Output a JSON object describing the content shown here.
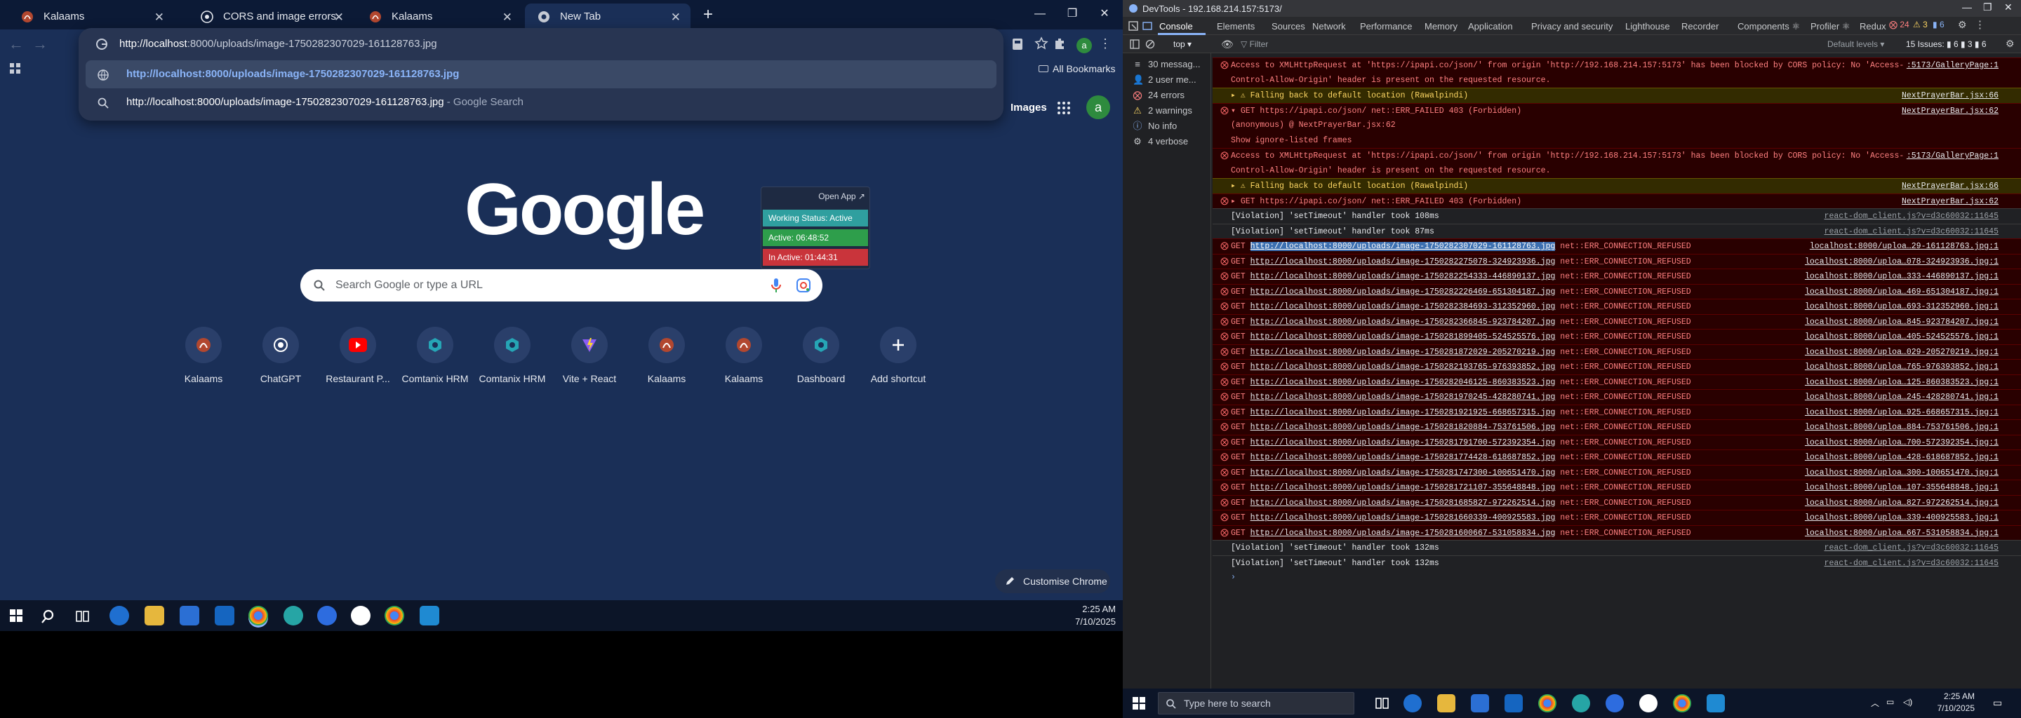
{
  "browser": {
    "tabs": [
      {
        "label": "Kalaams"
      },
      {
        "label": "CORS and image errors"
      },
      {
        "label": "Kalaams"
      },
      {
        "label": "New Tab"
      }
    ],
    "window_controls": {
      "minimize": "—",
      "maximize": "❐",
      "close": "✕"
    },
    "omnibox": {
      "value_host": "http://localhost",
      "value_path": ":8000/uploads/image-1750282307029-161128763.jpg",
      "suggestions": [
        {
          "text": "http://localhost:8000/uploads/image-1750282307029-161128763.jpg",
          "suffix": ""
        },
        {
          "text": "http://localhost:8000/uploads/image-1750282307029-161128763.jpg",
          "suffix": " - Google Search"
        }
      ]
    },
    "profile_initial": "a",
    "all_bookmarks": "All Bookmarks"
  },
  "newtab": {
    "images_link": "Images",
    "avatar_initial": "a",
    "logo": "Google",
    "search_placeholder": "Search Google or type a URL",
    "shortcuts": [
      {
        "label": "Kalaams",
        "icon": "kalaams-icon"
      },
      {
        "label": "ChatGPT",
        "icon": "chatgpt-icon"
      },
      {
        "label": "Restaurant P...",
        "icon": "youtube-icon"
      },
      {
        "label": "Comtanix HRM",
        "icon": "comtanix-icon"
      },
      {
        "label": "Comtanix HRM",
        "icon": "comtanix-icon"
      },
      {
        "label": "Vite + React",
        "icon": "vite-icon"
      },
      {
        "label": "Kalaams",
        "icon": "kalaams-icon"
      },
      {
        "label": "Kalaams",
        "icon": "kalaams-icon"
      },
      {
        "label": "Dashboard",
        "icon": "dashboard-icon"
      },
      {
        "label": "Add shortcut",
        "icon": "plus-icon"
      }
    ],
    "customise": "Customise Chrome"
  },
  "extension_popup": {
    "open_app": "Open App ↗",
    "working_status": "Working Status: Active",
    "active": "Active: 06:48:52",
    "inactive": "In Active: 01:44:31"
  },
  "taskbar_left": {
    "time": "2:25 AM",
    "date": "7/10/2025"
  },
  "devtools": {
    "title": "DevTools - 192.168.214.157:5173/",
    "tabs": [
      "Console",
      "Elements",
      "Sources",
      "Network",
      "Performance",
      "Memory",
      "Application",
      "Privacy and security",
      "Lighthouse",
      "Recorder",
      "Components ⚛",
      "Profiler ⚛",
      "Redux"
    ],
    "issue_counts": {
      "errors": "24",
      "warnings": "3",
      "info": "6"
    },
    "filter": {
      "context": "top ▾",
      "placeholder": "Filter",
      "levels": "Default levels ▾",
      "issues": "15 Issues: ▮ 6 ▮ 3 ▮ 6"
    },
    "sidebar": [
      {
        "label": "30 messag...",
        "icon": "list-icon"
      },
      {
        "label": "2 user me...",
        "icon": "user-icon"
      },
      {
        "label": "24 errors",
        "icon": "error-icon"
      },
      {
        "label": "2 warnings",
        "icon": "warning-icon"
      },
      {
        "label": "No info",
        "icon": "info-icon"
      },
      {
        "label": "4 verbose",
        "icon": "verbose-icon"
      }
    ],
    "log": [
      {
        "level": "err",
        "msg": "Access to XMLHttpRequest at 'https://ipapi.co/json/' from origin 'http://192.168.214.157:5173' has been blocked by CORS policy: No 'Access-",
        "src": ":5173/GalleryPage:1"
      },
      {
        "level": "err",
        "msg": "Control-Allow-Origin' header is present on the requested resource.",
        "src": "",
        "cont": true
      },
      {
        "level": "warn",
        "msg": "▸ ⚠ Falling back to default location (Rawalpindi)",
        "src": "NextPrayerBar.jsx:66"
      },
      {
        "level": "err",
        "msg": "▾ GET https://ipapi.co/json/ net::ERR_FAILED 403 (Forbidden)",
        "src": "NextPrayerBar.jsx:62"
      },
      {
        "level": "err",
        "msg": "    (anonymous) @ NextPrayerBar.jsx:62",
        "src": "",
        "cont": true
      },
      {
        "level": "err",
        "msg": "    Show ignore-listed frames",
        "src": "",
        "cont": true
      },
      {
        "level": "err",
        "msg": "Access to XMLHttpRequest at 'https://ipapi.co/json/' from origin 'http://192.168.214.157:5173' has been blocked by CORS policy: No 'Access-",
        "src": ":5173/GalleryPage:1"
      },
      {
        "level": "err",
        "msg": "Control-Allow-Origin' header is present on the requested resource.",
        "src": "",
        "cont": true
      },
      {
        "level": "warn",
        "msg": "▸ ⚠ Falling back to default location (Rawalpindi)",
        "src": "NextPrayerBar.jsx:66"
      },
      {
        "level": "err",
        "msg": "▸ GET https://ipapi.co/json/ net::ERR_FAILED 403 (Forbidden)",
        "src": "NextPrayerBar.jsx:62"
      },
      {
        "level": "plain",
        "msg": "[Violation] 'setTimeout' handler took 108ms",
        "src": "react-dom_client.js?v=d3c60032:11645"
      },
      {
        "level": "plain",
        "msg": "[Violation] 'setTimeout' handler took 87ms",
        "src": "react-dom_client.js?v=d3c60032:11645"
      },
      {
        "level": "err",
        "get": true,
        "url": "http://localhost:8000/uploads/image-1750282307029-161128763.jpg",
        "msg": " net::ERR_CONNECTION_REFUSED",
        "src": "localhost:8000/uploa…29-161128763.jpg:1",
        "selected": true
      },
      {
        "level": "err",
        "get": true,
        "url": "http://localhost:8000/uploads/image-1750282275078-324923936.jpg",
        "msg": " net::ERR_CONNECTION_REFUSED",
        "src": "localhost:8000/uploa…078-324923936.jpg:1"
      },
      {
        "level": "err",
        "get": true,
        "url": "http://localhost:8000/uploads/image-1750282254333-446890137.jpg",
        "msg": " net::ERR_CONNECTION_REFUSED",
        "src": "localhost:8000/uploa…333-446890137.jpg:1"
      },
      {
        "level": "err",
        "get": true,
        "url": "http://localhost:8000/uploads/image-1750282226469-651304187.jpg",
        "msg": " net::ERR_CONNECTION_REFUSED",
        "src": "localhost:8000/uploa…469-651304187.jpg:1"
      },
      {
        "level": "err",
        "get": true,
        "url": "http://localhost:8000/uploads/image-1750282384693-312352960.jpg",
        "msg": " net::ERR_CONNECTION_REFUSED",
        "src": "localhost:8000/uploa…693-312352960.jpg:1"
      },
      {
        "level": "err",
        "get": true,
        "url": "http://localhost:8000/uploads/image-1750282366845-923784207.jpg",
        "msg": " net::ERR_CONNECTION_REFUSED",
        "src": "localhost:8000/uploa…845-923784207.jpg:1"
      },
      {
        "level": "err",
        "get": true,
        "url": "http://localhost:8000/uploads/image-1750281899405-524525576.jpg",
        "msg": " net::ERR_CONNECTION_REFUSED",
        "src": "localhost:8000/uploa…405-524525576.jpg:1"
      },
      {
        "level": "err",
        "get": true,
        "url": "http://localhost:8000/uploads/image-1750281872029-205270219.jpg",
        "msg": " net::ERR_CONNECTION_REFUSED",
        "src": "localhost:8000/uploa…029-205270219.jpg:1"
      },
      {
        "level": "err",
        "get": true,
        "url": "http://localhost:8000/uploads/image-1750282193765-976393852.jpg",
        "msg": " net::ERR_CONNECTION_REFUSED",
        "src": "localhost:8000/uploa…765-976393852.jpg:1"
      },
      {
        "level": "err",
        "get": true,
        "url": "http://localhost:8000/uploads/image-1750282046125-860383523.jpg",
        "msg": " net::ERR_CONNECTION_REFUSED",
        "src": "localhost:8000/uploa…125-860383523.jpg:1"
      },
      {
        "level": "err",
        "get": true,
        "url": "http://localhost:8000/uploads/image-1750281970245-428280741.jpg",
        "msg": " net::ERR_CONNECTION_REFUSED",
        "src": "localhost:8000/uploa…245-428280741.jpg:1"
      },
      {
        "level": "err",
        "get": true,
        "url": "http://localhost:8000/uploads/image-1750281921925-668657315.jpg",
        "msg": " net::ERR_CONNECTION_REFUSED",
        "src": "localhost:8000/uploa…925-668657315.jpg:1"
      },
      {
        "level": "err",
        "get": true,
        "url": "http://localhost:8000/uploads/image-1750281820884-753761506.jpg",
        "msg": " net::ERR_CONNECTION_REFUSED",
        "src": "localhost:8000/uploa…884-753761506.jpg:1"
      },
      {
        "level": "err",
        "get": true,
        "url": "http://localhost:8000/uploads/image-1750281791700-572392354.jpg",
        "msg": " net::ERR_CONNECTION_REFUSED",
        "src": "localhost:8000/uploa…700-572392354.jpg:1"
      },
      {
        "level": "err",
        "get": true,
        "url": "http://localhost:8000/uploads/image-1750281774428-618687852.jpg",
        "msg": " net::ERR_CONNECTION_REFUSED",
        "src": "localhost:8000/uploa…428-618687852.jpg:1"
      },
      {
        "level": "err",
        "get": true,
        "url": "http://localhost:8000/uploads/image-1750281747300-100651470.jpg",
        "msg": " net::ERR_CONNECTION_REFUSED",
        "src": "localhost:8000/uploa…300-100651470.jpg:1"
      },
      {
        "level": "err",
        "get": true,
        "url": "http://localhost:8000/uploads/image-1750281721107-355648848.jpg",
        "msg": " net::ERR_CONNECTION_REFUSED",
        "src": "localhost:8000/uploa…107-355648848.jpg:1"
      },
      {
        "level": "err",
        "get": true,
        "url": "http://localhost:8000/uploads/image-1750281685827-972262514.jpg",
        "msg": " net::ERR_CONNECTION_REFUSED",
        "src": "localhost:8000/uploa…827-972262514.jpg:1"
      },
      {
        "level": "err",
        "get": true,
        "url": "http://localhost:8000/uploads/image-1750281660339-400925583.jpg",
        "msg": " net::ERR_CONNECTION_REFUSED",
        "src": "localhost:8000/uploa…339-400925583.jpg:1"
      },
      {
        "level": "err",
        "get": true,
        "url": "http://localhost:8000/uploads/image-1750281600667-531058834.jpg",
        "msg": " net::ERR_CONNECTION_REFUSED",
        "src": "localhost:8000/uploa…667-531058834.jpg:1"
      },
      {
        "level": "plain",
        "msg": "[Violation] 'setTimeout' handler took 132ms",
        "src": "react-dom_client.js?v=d3c60032:11645"
      },
      {
        "level": "plain",
        "msg": "[Violation] 'setTimeout' handler took 132ms",
        "src": "react-dom_client.js?v=d3c60032:11645"
      },
      {
        "level": "prompt",
        "msg": "›",
        "src": ""
      }
    ]
  },
  "taskbar_right": {
    "search_placeholder": "Type here to search",
    "time": "2:25 AM",
    "date": "7/10/2025"
  },
  "colors": {
    "accent": "#8ab4f8",
    "error_bg": "#290000",
    "warn_bg": "#332b00",
    "newtab_bg": "#1a2f57"
  }
}
